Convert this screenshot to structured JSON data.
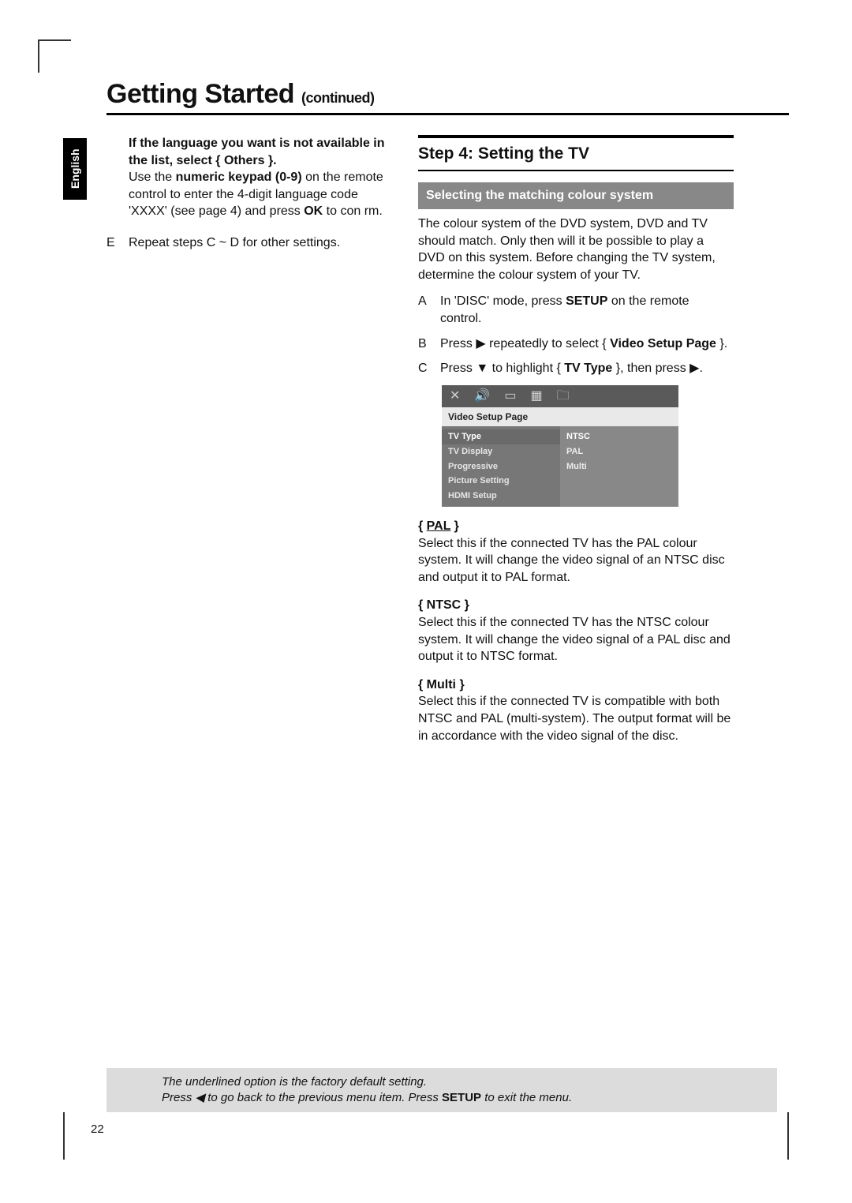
{
  "title_main": "Getting Started",
  "title_cont": "(continued)",
  "lang_tab": "English",
  "left": {
    "intro_bold1": "If the language you want is not available in the list, select { Others }.",
    "intro_line2a": "Use the ",
    "intro_kb": "numeric keypad (0-9)",
    "intro_line2b": " on the remote control to enter the 4-digit language code 'XXXX' (see page 4) and press ",
    "intro_ok": "OK",
    "intro_line2c": " to con rm.",
    "repeat_marker": "E",
    "repeat_text": "Repeat steps C ~ D for other settings."
  },
  "right": {
    "step_heading": "Step 4:  Setting the TV",
    "sub_heading": "Selecting the matching colour system",
    "para1": "The colour system of the DVD system, DVD and TV should match. Only then will it be possible to play a DVD on this system.  Before changing the TV system, determine the colour system of your TV.",
    "sA_marker": "A",
    "sA_a": "In 'DISC' mode, press ",
    "sA_b": "SETUP",
    "sA_c": " on the remote control.",
    "sB_marker": "B",
    "sB_a": "Press ",
    "sB_b": " repeatedly to select { ",
    "sB_c": "Video Setup Page",
    "sB_d": " }.",
    "sC_marker": "C",
    "sC_a": "Press ",
    "sC_b": " to highlight { ",
    "sC_c": "TV Type",
    "sC_d": " }, then press ",
    "sC_e": ".",
    "osd_title": "Video Setup Page",
    "osd_menu": [
      "TV Type",
      "TV Display",
      "Progressive",
      "Picture Setting",
      "HDMI Setup"
    ],
    "osd_vals": [
      "NTSC",
      "PAL",
      "Multi"
    ],
    "pal_head": "PAL",
    "pal_body": "Select this if the connected TV has the PAL colour system. It will change the video signal of an NTSC disc and output it to PAL format.",
    "ntsc_head": "NTSC",
    "ntsc_body": "Select this if the connected TV has the NTSC colour system. It will change the video signal of a PAL disc and output it to NTSC format.",
    "multi_head": "Multi",
    "multi_body": "Select this if the connected TV is compatible with both NTSC and PAL (multi-system).  The output format will be in accordance with the video signal of the disc."
  },
  "tips": {
    "label": "   ",
    "line1": "The underlined option is the factory default setting.",
    "line2a": "Press ",
    "line2b": " to go back to the previous menu item.  Press ",
    "line2c": "SETUP",
    "line2d": " to exit the menu."
  },
  "page_num": "22"
}
